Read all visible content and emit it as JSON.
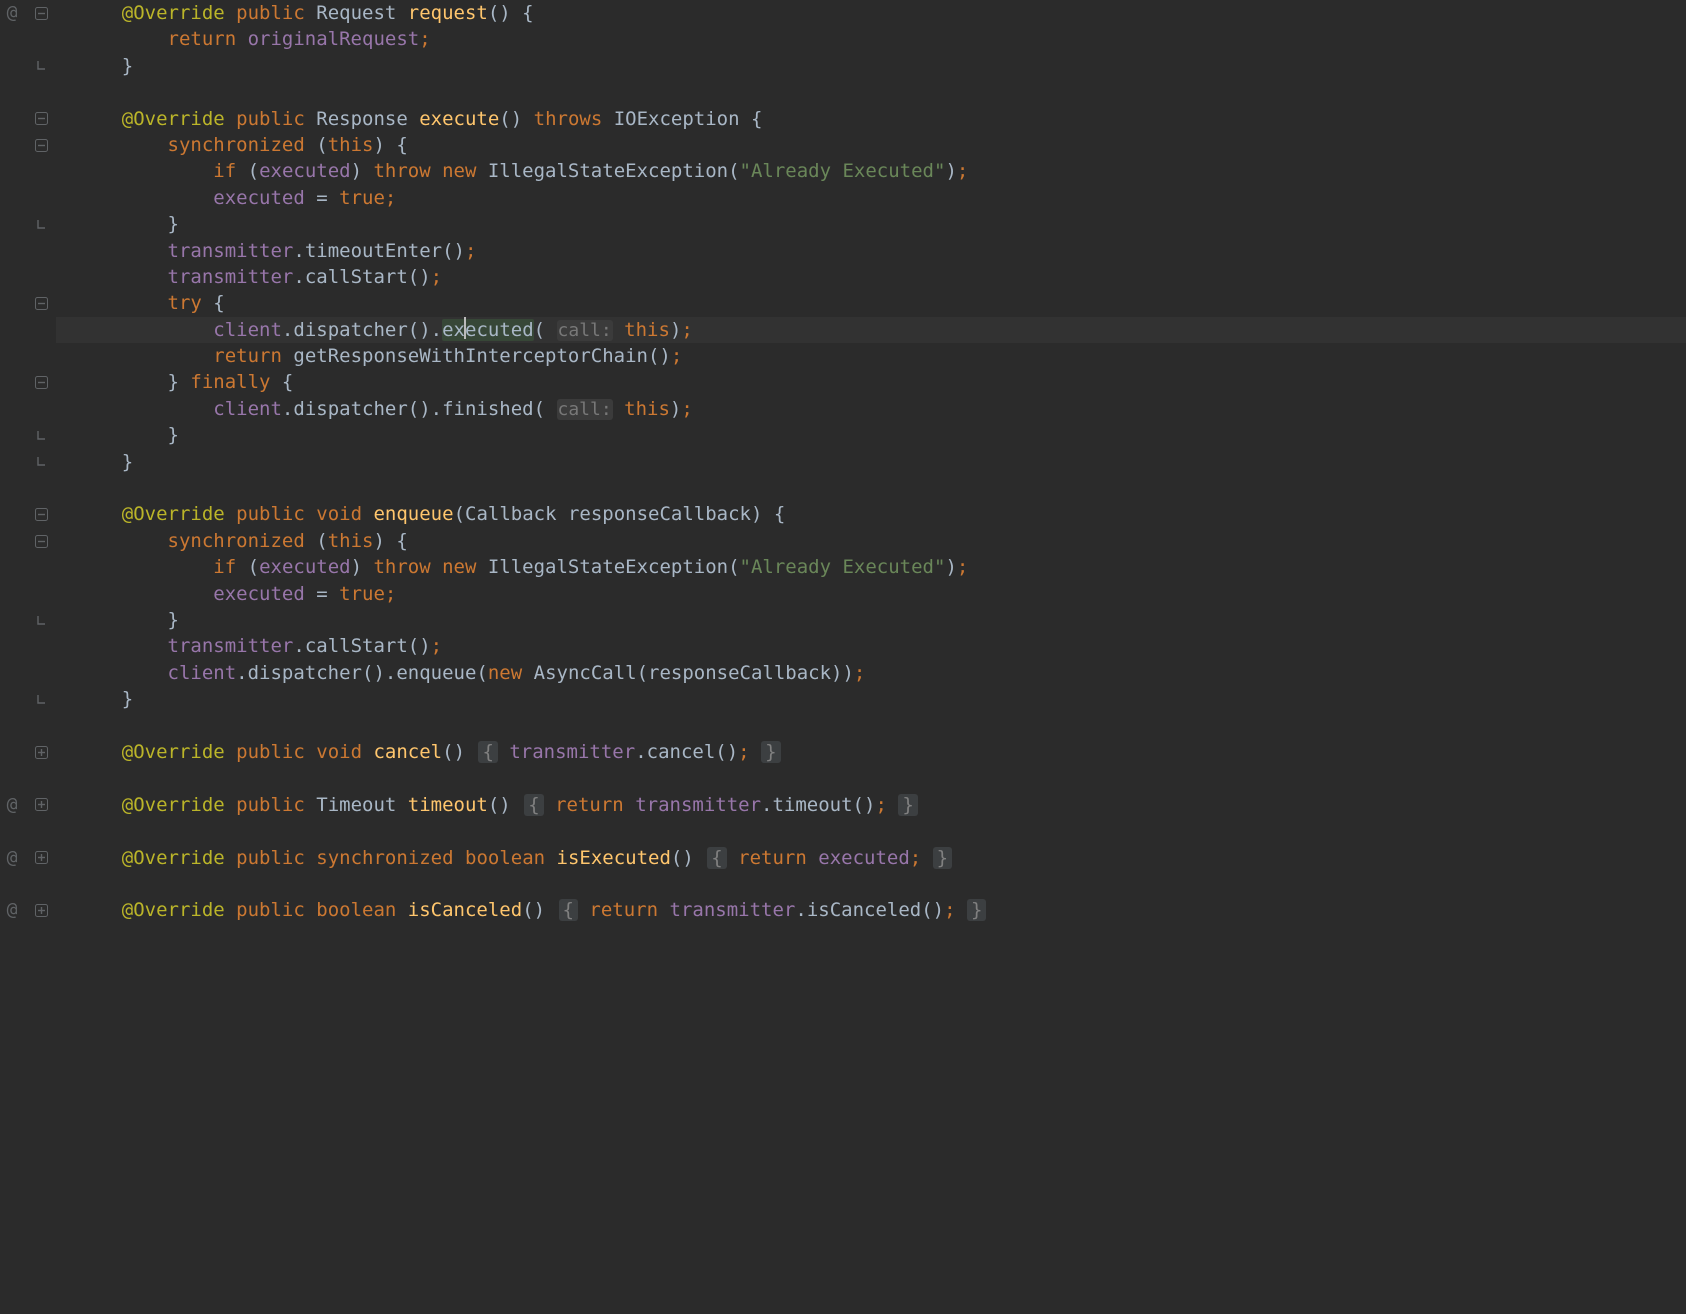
{
  "paramHint": "call:",
  "lines": {
    "l1": [
      [
        "ann",
        "@Override"
      ],
      [
        "plain",
        " "
      ],
      [
        "key",
        "public"
      ],
      [
        "plain",
        " "
      ],
      [
        "type",
        "Request "
      ],
      [
        "call",
        "request"
      ],
      [
        "plain",
        "() {"
      ]
    ],
    "l2": [
      [
        "key",
        "return"
      ],
      [
        "plain",
        " "
      ],
      [
        "field",
        "originalRequest"
      ],
      [
        "semi",
        ";"
      ]
    ],
    "l3": [
      [
        "plain",
        "}"
      ]
    ],
    "l4": [],
    "l5": [
      [
        "ann",
        "@Override"
      ],
      [
        "plain",
        " "
      ],
      [
        "key",
        "public"
      ],
      [
        "plain",
        " "
      ],
      [
        "type",
        "Response "
      ],
      [
        "call",
        "execute"
      ],
      [
        "plain",
        "() "
      ],
      [
        "key",
        "throws"
      ],
      [
        "plain",
        " "
      ],
      [
        "type",
        "IOException {"
      ]
    ],
    "l6": [
      [
        "key",
        "synchronized"
      ],
      [
        "plain",
        " ("
      ],
      [
        "key",
        "this"
      ],
      [
        "plain",
        ") {"
      ]
    ],
    "l7": [
      [
        "key",
        "if"
      ],
      [
        "plain",
        " ("
      ],
      [
        "field",
        "executed"
      ],
      [
        "plain",
        ") "
      ],
      [
        "key",
        "throw new"
      ],
      [
        "plain",
        " IllegalStateException("
      ],
      [
        "str",
        "\"Already Executed\""
      ],
      [
        "plain",
        ")"
      ],
      [
        "semi",
        ";"
      ]
    ],
    "l8": [
      [
        "field",
        "executed"
      ],
      [
        "plain",
        " = "
      ],
      [
        "key",
        "true"
      ],
      [
        "semi",
        ";"
      ]
    ],
    "l9": [
      [
        "plain",
        "}"
      ]
    ],
    "l10": [
      [
        "field",
        "transmitter"
      ],
      [
        "plain",
        "."
      ],
      [
        "plain",
        "timeoutEnter()"
      ],
      [
        "semi",
        ";"
      ]
    ],
    "l11": [
      [
        "field",
        "transmitter"
      ],
      [
        "plain",
        "."
      ],
      [
        "plain",
        "callStart()"
      ],
      [
        "semi",
        ";"
      ]
    ],
    "l12": [
      [
        "key",
        "try"
      ],
      [
        "plain",
        " {"
      ]
    ],
    "l13_a": [
      [
        "field",
        "client"
      ],
      [
        "plain",
        "."
      ],
      [
        "plain",
        "dispatcher()"
      ],
      [
        "plain",
        "."
      ]
    ],
    "l13_word": "executed",
    "l13_b": [
      [
        "plain",
        "( "
      ]
    ],
    "l13_c": [
      [
        "plain",
        " "
      ],
      [
        "key",
        "this"
      ],
      [
        "plain",
        ")"
      ],
      [
        "semi",
        ";"
      ]
    ],
    "l14": [
      [
        "key",
        "return"
      ],
      [
        "plain",
        " "
      ],
      [
        "plain",
        "getResponseWithInterceptorChain()"
      ],
      [
        "semi",
        ";"
      ]
    ],
    "l15": [
      [
        "plain",
        "} "
      ],
      [
        "key",
        "finally"
      ],
      [
        "plain",
        " {"
      ]
    ],
    "l16_a": [
      [
        "field",
        "client"
      ],
      [
        "plain",
        "."
      ],
      [
        "plain",
        "dispatcher()"
      ],
      [
        "plain",
        "."
      ],
      [
        "plain",
        "finished( "
      ]
    ],
    "l16_b": [
      [
        "plain",
        " "
      ],
      [
        "key",
        "this"
      ],
      [
        "plain",
        ")"
      ],
      [
        "semi",
        ";"
      ]
    ],
    "l17": [
      [
        "plain",
        "}"
      ]
    ],
    "l18": [
      [
        "plain",
        "}"
      ]
    ],
    "l19": [],
    "l20": [
      [
        "ann",
        "@Override"
      ],
      [
        "plain",
        " "
      ],
      [
        "key",
        "public"
      ],
      [
        "plain",
        " "
      ],
      [
        "key",
        "void"
      ],
      [
        "plain",
        " "
      ],
      [
        "call",
        "enqueue"
      ],
      [
        "plain",
        "(Callback responseCallback) {"
      ]
    ],
    "l21": [
      [
        "key",
        "synchronized"
      ],
      [
        "plain",
        " ("
      ],
      [
        "key",
        "this"
      ],
      [
        "plain",
        ") {"
      ]
    ],
    "l22": [
      [
        "key",
        "if"
      ],
      [
        "plain",
        " ("
      ],
      [
        "field",
        "executed"
      ],
      [
        "plain",
        ") "
      ],
      [
        "key",
        "throw new"
      ],
      [
        "plain",
        " IllegalStateException("
      ],
      [
        "str",
        "\"Already Executed\""
      ],
      [
        "plain",
        ")"
      ],
      [
        "semi",
        ";"
      ]
    ],
    "l23": [
      [
        "field",
        "executed"
      ],
      [
        "plain",
        " = "
      ],
      [
        "key",
        "true"
      ],
      [
        "semi",
        ";"
      ]
    ],
    "l24": [
      [
        "plain",
        "}"
      ]
    ],
    "l25": [
      [
        "field",
        "transmitter"
      ],
      [
        "plain",
        "."
      ],
      [
        "plain",
        "callStart()"
      ],
      [
        "semi",
        ";"
      ]
    ],
    "l26": [
      [
        "field",
        "client"
      ],
      [
        "plain",
        "."
      ],
      [
        "plain",
        "dispatcher()"
      ],
      [
        "plain",
        "."
      ],
      [
        "plain",
        "enqueue("
      ],
      [
        "key",
        "new"
      ],
      [
        "plain",
        " AsyncCall(responseCallback))"
      ],
      [
        "semi",
        ";"
      ]
    ],
    "l27": [
      [
        "plain",
        "}"
      ]
    ],
    "l28": [],
    "l29a": [
      [
        "ann",
        "@Override"
      ],
      [
        "plain",
        " "
      ],
      [
        "key",
        "public"
      ],
      [
        "plain",
        " "
      ],
      [
        "key",
        "void"
      ],
      [
        "plain",
        " "
      ],
      [
        "call",
        "cancel"
      ],
      [
        "plain",
        "() "
      ]
    ],
    "l29b": [
      [
        "plain",
        " "
      ],
      [
        "field",
        "transmitter"
      ],
      [
        "plain",
        "."
      ],
      [
        "plain",
        "cancel()"
      ],
      [
        "semi",
        ";"
      ],
      [
        "plain",
        " "
      ]
    ],
    "l30": [],
    "l31a": [
      [
        "ann",
        "@Override"
      ],
      [
        "plain",
        " "
      ],
      [
        "key",
        "public"
      ],
      [
        "plain",
        " "
      ],
      [
        "type",
        "Timeout "
      ],
      [
        "call",
        "timeout"
      ],
      [
        "plain",
        "() "
      ]
    ],
    "l31b": [
      [
        "plain",
        " "
      ],
      [
        "key",
        "return"
      ],
      [
        "plain",
        " "
      ],
      [
        "field",
        "transmitter"
      ],
      [
        "plain",
        "."
      ],
      [
        "plain",
        "timeout()"
      ],
      [
        "semi",
        ";"
      ],
      [
        "plain",
        " "
      ]
    ],
    "l32": [],
    "l33a": [
      [
        "ann",
        "@Override"
      ],
      [
        "plain",
        " "
      ],
      [
        "key",
        "public"
      ],
      [
        "plain",
        " "
      ],
      [
        "key",
        "synchronized"
      ],
      [
        "plain",
        " "
      ],
      [
        "key",
        "boolean"
      ],
      [
        "plain",
        " "
      ],
      [
        "call",
        "isExecuted"
      ],
      [
        "plain",
        "() "
      ]
    ],
    "l33b": [
      [
        "plain",
        " "
      ],
      [
        "key",
        "return"
      ],
      [
        "plain",
        " "
      ],
      [
        "field",
        "executed"
      ],
      [
        "semi",
        ";"
      ],
      [
        "plain",
        " "
      ]
    ],
    "l34": [],
    "l35a": [
      [
        "ann",
        "@Override"
      ],
      [
        "plain",
        " "
      ],
      [
        "key",
        "public"
      ],
      [
        "plain",
        " "
      ],
      [
        "key",
        "boolean"
      ],
      [
        "plain",
        " "
      ],
      [
        "call",
        "isCanceled"
      ],
      [
        "plain",
        "() "
      ]
    ],
    "l35b": [
      [
        "plain",
        " "
      ],
      [
        "key",
        "return"
      ],
      [
        "plain",
        " "
      ],
      [
        "field",
        "transmitter"
      ],
      [
        "plain",
        "."
      ],
      [
        "plain",
        "isCanceled()"
      ],
      [
        "semi",
        ";"
      ],
      [
        "plain",
        " "
      ]
    ]
  },
  "indents": {
    "l1": 2,
    "l2": 4,
    "l3": 2,
    "l4": 0,
    "l5": 2,
    "l6": 4,
    "l7": 6,
    "l8": 6,
    "l9": 4,
    "l10": 4,
    "l11": 4,
    "l12": 4,
    "l13": 6,
    "l14": 6,
    "l15": 4,
    "l16": 6,
    "l17": 4,
    "l18": 2,
    "l19": 0,
    "l20": 2,
    "l21": 4,
    "l22": 6,
    "l23": 6,
    "l24": 4,
    "l25": 4,
    "l26": 4,
    "l27": 2,
    "l28": 0,
    "l29": 2,
    "l30": 0,
    "l31": 2,
    "l32": 0,
    "l33": 2,
    "l34": 0,
    "l35": 2
  },
  "gutter": [
    {
      "left": "@",
      "right": "minus"
    },
    {
      "left": "",
      "right": ""
    },
    {
      "left": "",
      "right": "end"
    },
    {
      "left": "",
      "right": ""
    },
    {
      "left": "",
      "right": "minus"
    },
    {
      "left": "",
      "right": "minus"
    },
    {
      "left": "",
      "right": ""
    },
    {
      "left": "",
      "right": ""
    },
    {
      "left": "",
      "right": "end"
    },
    {
      "left": "",
      "right": ""
    },
    {
      "left": "",
      "right": ""
    },
    {
      "left": "",
      "right": "minus"
    },
    {
      "left": "",
      "right": ""
    },
    {
      "left": "",
      "right": ""
    },
    {
      "left": "",
      "right": "minus"
    },
    {
      "left": "",
      "right": ""
    },
    {
      "left": "",
      "right": "end"
    },
    {
      "left": "",
      "right": "end"
    },
    {
      "left": "",
      "right": ""
    },
    {
      "left": "",
      "right": "minus"
    },
    {
      "left": "",
      "right": "minus"
    },
    {
      "left": "",
      "right": ""
    },
    {
      "left": "",
      "right": ""
    },
    {
      "left": "",
      "right": "end"
    },
    {
      "left": "",
      "right": ""
    },
    {
      "left": "",
      "right": ""
    },
    {
      "left": "",
      "right": "end"
    },
    {
      "left": "",
      "right": ""
    },
    {
      "left": "",
      "right": "plus"
    },
    {
      "left": "",
      "right": ""
    },
    {
      "left": "@",
      "right": "plus"
    },
    {
      "left": "",
      "right": ""
    },
    {
      "left": "@",
      "right": "plus"
    },
    {
      "left": "",
      "right": ""
    },
    {
      "left": "@",
      "right": "plus"
    }
  ]
}
